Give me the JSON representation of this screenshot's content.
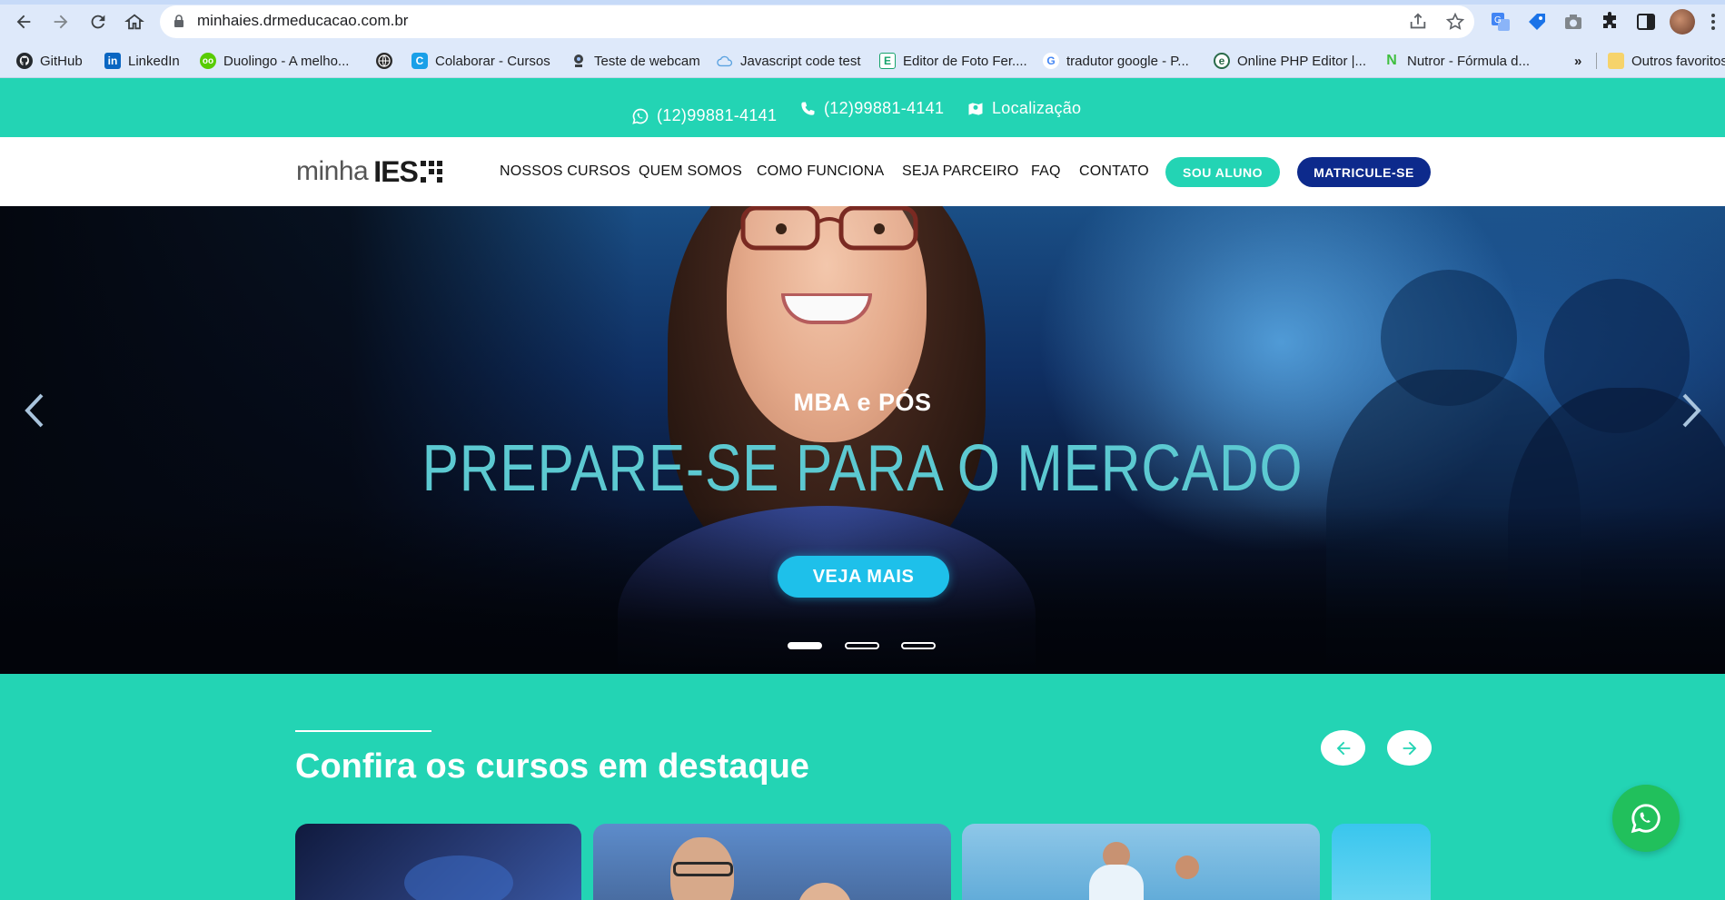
{
  "browser": {
    "url": "minhaies.drmeducacao.com.br",
    "bookmarks": [
      {
        "label": "GitHub",
        "icon": "github-icon"
      },
      {
        "label": "LinkedIn",
        "icon": "linkedin-icon"
      },
      {
        "label": "Duolingo - A melho...",
        "icon": "duolingo-icon"
      },
      {
        "label": "",
        "icon": "globe-icon"
      },
      {
        "label": "Colaborar - Cursos",
        "icon": "colaborar-icon"
      },
      {
        "label": "Teste de webcam",
        "icon": "webcam-icon"
      },
      {
        "label": "Javascript code test",
        "icon": "cloud-icon"
      },
      {
        "label": "Editor de Foto Fer....",
        "icon": "photo-editor-icon"
      },
      {
        "label": "tradutor google - P...",
        "icon": "google-icon"
      },
      {
        "label": "Online PHP Editor |...",
        "icon": "php-editor-icon"
      },
      {
        "label": "Nutror - Fórmula d...",
        "icon": "nutror-icon"
      }
    ],
    "more_bookmarks": "»",
    "other_bookmarks": "Outros favoritos"
  },
  "topbar": {
    "whatsapp": "(12)99881-4141",
    "phone": "(12)99881-4141",
    "location": "Localização"
  },
  "header": {
    "logo_minha": "minha",
    "logo_ies": "IES",
    "menu": [
      "NOSSOS CURSOS",
      "QUEM SOMOS",
      "COMO FUNCIONA",
      "SEJA PARCEIRO",
      "FAQ",
      "CONTATO"
    ],
    "btn_aluno": "SOU ALUNO",
    "btn_matricule": "MATRICULE-SE"
  },
  "hero": {
    "subtitle": "MBA e PÓS",
    "title": "PREPARE-SE PARA O MERCADO",
    "button": "VEJA MAIS",
    "slides_total": 3,
    "active_slide": 1
  },
  "courses": {
    "title": "Confira os cursos em destaque"
  },
  "colors": {
    "accent": "#23d4b4",
    "navy": "#0d2a8c",
    "hero_button": "#1ec0ea",
    "whatsapp": "#21c05c"
  }
}
